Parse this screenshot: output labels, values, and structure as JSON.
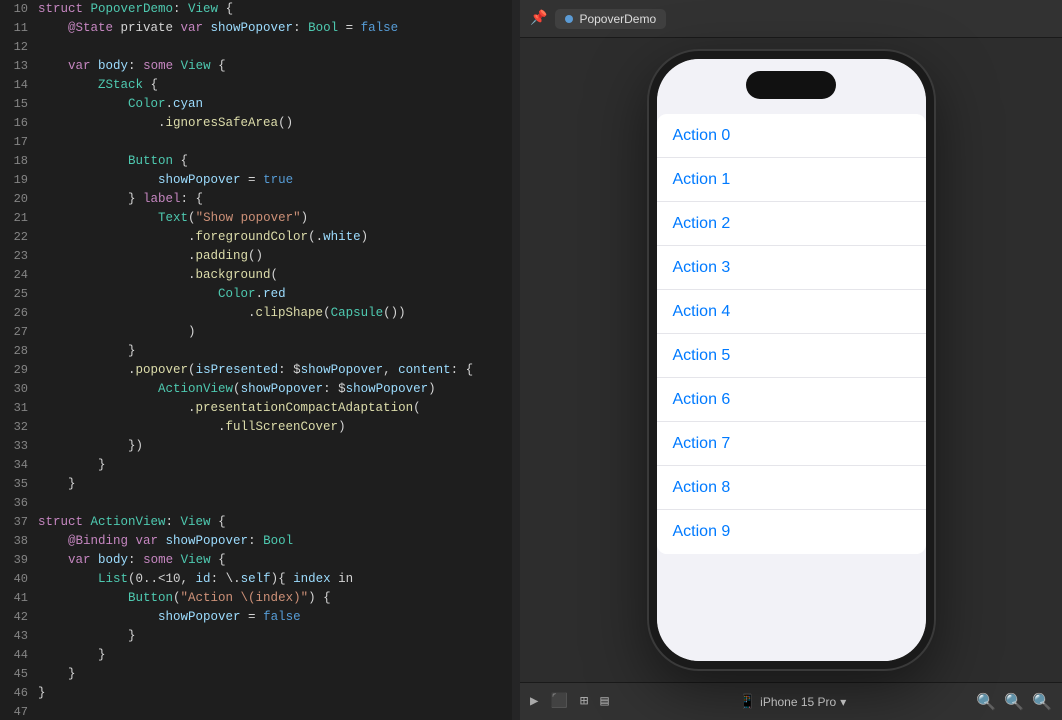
{
  "editor": {
    "lines": [
      {
        "num": 10,
        "tokens": [
          {
            "t": "kw",
            "v": "struct "
          },
          {
            "t": "type",
            "v": "PopoverDemo"
          },
          {
            "t": "plain",
            "v": ": "
          },
          {
            "t": "type",
            "v": "View"
          },
          {
            "t": "plain",
            "v": " {"
          }
        ]
      },
      {
        "num": 11,
        "tokens": [
          {
            "t": "attr",
            "v": "    @State"
          },
          {
            "t": "plain",
            "v": " private "
          },
          {
            "t": "kw",
            "v": "var "
          },
          {
            "t": "prop",
            "v": "showPopover"
          },
          {
            "t": "plain",
            "v": ": "
          },
          {
            "t": "type",
            "v": "Bool"
          },
          {
            "t": "plain",
            "v": " = "
          },
          {
            "t": "kw2",
            "v": "false"
          }
        ]
      },
      {
        "num": 12,
        "tokens": []
      },
      {
        "num": 13,
        "tokens": [
          {
            "t": "plain",
            "v": "    "
          },
          {
            "t": "kw",
            "v": "var "
          },
          {
            "t": "prop",
            "v": "body"
          },
          {
            "t": "plain",
            "v": ": "
          },
          {
            "t": "kw",
            "v": "some "
          },
          {
            "t": "type",
            "v": "View"
          },
          {
            "t": "plain",
            "v": " {"
          }
        ]
      },
      {
        "num": 14,
        "tokens": [
          {
            "t": "plain",
            "v": "        "
          },
          {
            "t": "type",
            "v": "ZStack"
          },
          {
            "t": "plain",
            "v": " {"
          }
        ]
      },
      {
        "num": 15,
        "tokens": [
          {
            "t": "plain",
            "v": "            "
          },
          {
            "t": "type",
            "v": "Color"
          },
          {
            "t": "plain",
            "v": "."
          },
          {
            "t": "prop",
            "v": "cyan"
          }
        ]
      },
      {
        "num": 16,
        "tokens": [
          {
            "t": "plain",
            "v": "                ."
          },
          {
            "t": "func",
            "v": "ignoresSafeArea"
          },
          {
            "t": "plain",
            "v": "()"
          }
        ]
      },
      {
        "num": 17,
        "tokens": []
      },
      {
        "num": 18,
        "tokens": [
          {
            "t": "plain",
            "v": "            "
          },
          {
            "t": "type",
            "v": "Button"
          },
          {
            "t": "plain",
            "v": " {"
          }
        ]
      },
      {
        "num": 19,
        "tokens": [
          {
            "t": "plain",
            "v": "                "
          },
          {
            "t": "prop",
            "v": "showPopover"
          },
          {
            "t": "plain",
            "v": " = "
          },
          {
            "t": "kw2",
            "v": "true"
          }
        ]
      },
      {
        "num": 20,
        "tokens": [
          {
            "t": "plain",
            "v": "            } "
          },
          {
            "t": "kw",
            "v": "label"
          },
          {
            "t": "plain",
            "v": ": {"
          }
        ]
      },
      {
        "num": 21,
        "tokens": [
          {
            "t": "plain",
            "v": "                "
          },
          {
            "t": "type",
            "v": "Text"
          },
          {
            "t": "plain",
            "v": "("
          },
          {
            "t": "str",
            "v": "\"Show popover\""
          },
          {
            "t": "plain",
            "v": ")"
          }
        ]
      },
      {
        "num": 22,
        "tokens": [
          {
            "t": "plain",
            "v": "                    ."
          },
          {
            "t": "func",
            "v": "foregroundColor"
          },
          {
            "t": "plain",
            "v": "(."
          },
          {
            "t": "prop",
            "v": "white"
          },
          {
            "t": "plain",
            "v": ")"
          }
        ]
      },
      {
        "num": 23,
        "tokens": [
          {
            "t": "plain",
            "v": "                    ."
          },
          {
            "t": "func",
            "v": "padding"
          },
          {
            "t": "plain",
            "v": "()"
          }
        ]
      },
      {
        "num": 24,
        "tokens": [
          {
            "t": "plain",
            "v": "                    ."
          },
          {
            "t": "func",
            "v": "background"
          },
          {
            "t": "plain",
            "v": "("
          }
        ]
      },
      {
        "num": 25,
        "tokens": [
          {
            "t": "plain",
            "v": "                        "
          },
          {
            "t": "type",
            "v": "Color"
          },
          {
            "t": "plain",
            "v": "."
          },
          {
            "t": "prop",
            "v": "red"
          }
        ]
      },
      {
        "num": 26,
        "tokens": [
          {
            "t": "plain",
            "v": "                            ."
          },
          {
            "t": "func",
            "v": "clipShape"
          },
          {
            "t": "plain",
            "v": "("
          },
          {
            "t": "type",
            "v": "Capsule"
          },
          {
            "t": "plain",
            "v": "())"
          }
        ]
      },
      {
        "num": 27,
        "tokens": [
          {
            "t": "plain",
            "v": "                    )"
          }
        ]
      },
      {
        "num": 28,
        "tokens": [
          {
            "t": "plain",
            "v": "            }"
          }
        ]
      },
      {
        "num": 29,
        "tokens": [
          {
            "t": "plain",
            "v": "            ."
          },
          {
            "t": "func",
            "v": "popover"
          },
          {
            "t": "plain",
            "v": "("
          },
          {
            "t": "param",
            "v": "isPresented"
          },
          {
            "t": "plain",
            "v": ": $"
          },
          {
            "t": "prop",
            "v": "showPopover"
          },
          {
            "t": "plain",
            "v": ", "
          },
          {
            "t": "param",
            "v": "content"
          },
          {
            "t": "plain",
            "v": ": {"
          }
        ]
      },
      {
        "num": 30,
        "tokens": [
          {
            "t": "plain",
            "v": "                "
          },
          {
            "t": "type",
            "v": "ActionView"
          },
          {
            "t": "plain",
            "v": "("
          },
          {
            "t": "param",
            "v": "showPopover"
          },
          {
            "t": "plain",
            "v": ": $"
          },
          {
            "t": "prop",
            "v": "showPopover"
          },
          {
            "t": "plain",
            "v": ")"
          }
        ]
      },
      {
        "num": 31,
        "tokens": [
          {
            "t": "plain",
            "v": "                    ."
          },
          {
            "t": "func",
            "v": "presentationCompactAdaptation"
          },
          {
            "t": "plain",
            "v": "("
          }
        ]
      },
      {
        "num": 32,
        "tokens": [
          {
            "t": "plain",
            "v": "                        ."
          },
          {
            "t": "func",
            "v": "fullScreenCover"
          },
          {
            "t": "plain",
            "v": ")"
          }
        ]
      },
      {
        "num": 33,
        "tokens": [
          {
            "t": "plain",
            "v": "            })"
          }
        ]
      },
      {
        "num": 34,
        "tokens": [
          {
            "t": "plain",
            "v": "        }"
          }
        ]
      },
      {
        "num": 35,
        "tokens": [
          {
            "t": "plain",
            "v": "    }"
          }
        ]
      },
      {
        "num": 36,
        "tokens": []
      },
      {
        "num": 37,
        "tokens": [
          {
            "t": "kw",
            "v": "struct "
          },
          {
            "t": "type",
            "v": "ActionView"
          },
          {
            "t": "plain",
            "v": ": "
          },
          {
            "t": "type",
            "v": "View"
          },
          {
            "t": "plain",
            "v": " {"
          }
        ]
      },
      {
        "num": 38,
        "tokens": [
          {
            "t": "attr",
            "v": "    @Binding"
          },
          {
            "t": "plain",
            "v": " "
          },
          {
            "t": "kw",
            "v": "var "
          },
          {
            "t": "prop",
            "v": "showPopover"
          },
          {
            "t": "plain",
            "v": ": "
          },
          {
            "t": "type",
            "v": "Bool"
          }
        ]
      },
      {
        "num": 39,
        "tokens": [
          {
            "t": "plain",
            "v": "    "
          },
          {
            "t": "kw",
            "v": "var "
          },
          {
            "t": "prop",
            "v": "body"
          },
          {
            "t": "plain",
            "v": ": "
          },
          {
            "t": "kw",
            "v": "some "
          },
          {
            "t": "type",
            "v": "View"
          },
          {
            "t": "plain",
            "v": " {"
          }
        ]
      },
      {
        "num": 40,
        "tokens": [
          {
            "t": "plain",
            "v": "        "
          },
          {
            "t": "type",
            "v": "List"
          },
          {
            "t": "plain",
            "v": "(0..<10, "
          },
          {
            "t": "param",
            "v": "id"
          },
          {
            "t": "plain",
            "v": ": \\."
          },
          {
            "t": "prop",
            "v": "self"
          },
          {
            "t": "plain",
            "v": "){ "
          },
          {
            "t": "prop",
            "v": "index"
          },
          {
            "t": "plain",
            "v": " in"
          }
        ]
      },
      {
        "num": 41,
        "tokens": [
          {
            "t": "plain",
            "v": "            "
          },
          {
            "t": "type",
            "v": "Button"
          },
          {
            "t": "plain",
            "v": "("
          },
          {
            "t": "str",
            "v": "\"Action \\(index)\""
          },
          {
            "t": "plain",
            "v": ") {"
          }
        ]
      },
      {
        "num": 42,
        "tokens": [
          {
            "t": "plain",
            "v": "                "
          },
          {
            "t": "prop",
            "v": "showPopover"
          },
          {
            "t": "plain",
            "v": " = "
          },
          {
            "t": "kw2",
            "v": "false"
          }
        ]
      },
      {
        "num": 43,
        "tokens": [
          {
            "t": "plain",
            "v": "            }"
          }
        ]
      },
      {
        "num": 44,
        "tokens": [
          {
            "t": "plain",
            "v": "        }"
          }
        ]
      },
      {
        "num": 45,
        "tokens": [
          {
            "t": "plain",
            "v": "    }"
          }
        ]
      },
      {
        "num": 46,
        "tokens": [
          {
            "t": "plain",
            "v": "}"
          }
        ]
      },
      {
        "num": 47,
        "tokens": []
      }
    ]
  },
  "preview": {
    "tab_label": "PopoverDemo",
    "actions": [
      "Action 0",
      "Action 1",
      "Action 2",
      "Action 3",
      "Action 4",
      "Action 5",
      "Action 6",
      "Action 7",
      "Action 8",
      "Action 9"
    ],
    "device_label": "iPhone 15 Pro",
    "bottom_icons": [
      "▶",
      "⬛",
      "⊞",
      "⬜"
    ]
  }
}
